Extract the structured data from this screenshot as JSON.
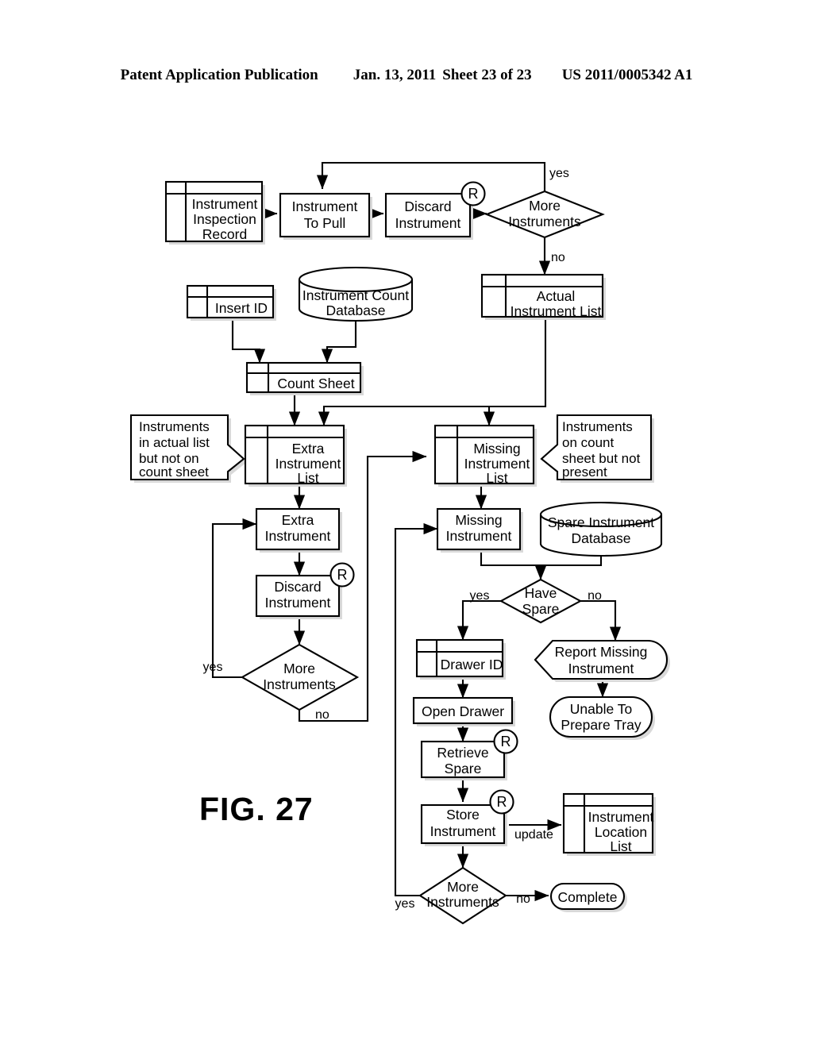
{
  "header": {
    "publication": "Patent Application Publication",
    "date": "Jan. 13, 2011",
    "sheet": "Sheet 23 of 23",
    "patent_number": "US 2011/0005342 A1"
  },
  "figure": {
    "label": "FIG. 27"
  },
  "colors": {
    "stroke": "#000000",
    "fill": "#ffffff",
    "shadow": "#d9d9d9"
  },
  "nodes": {
    "instrument_inspection_record": {
      "line1": "Instrument",
      "line2": "Inspection",
      "line3": "Record",
      "shape": "list"
    },
    "instrument_to_pull": {
      "line1": "Instrument",
      "line2": "To Pull",
      "shape": "process"
    },
    "discard_instrument_top": {
      "line1": "Discard",
      "line2": "Instrument",
      "shape": "process",
      "badge": "R"
    },
    "more_instruments_top": {
      "line1": "More",
      "line2": "Instruments",
      "shape": "decision"
    },
    "insert_id": {
      "line1": "Insert ID",
      "shape": "list"
    },
    "instrument_count_database": {
      "line1": "Instrument Count",
      "line2": "Database",
      "shape": "database"
    },
    "actual_instrument_list": {
      "line1": "Actual",
      "line2": "Instrument List",
      "shape": "list"
    },
    "count_sheet": {
      "line1": "Count Sheet",
      "shape": "list"
    },
    "extra_instrument_list": {
      "line1": "Extra",
      "line2": "Instrument",
      "line3": "List",
      "shape": "list"
    },
    "missing_instrument_list": {
      "line1": "Missing",
      "line2": "Instrument",
      "line3": "List",
      "shape": "list"
    },
    "extra_instrument": {
      "line1": "Extra",
      "line2": "Instrument",
      "shape": "process"
    },
    "discard_instrument_mid": {
      "line1": "Discard",
      "line2": "Instrument",
      "shape": "process",
      "badge": "R"
    },
    "more_instruments_left": {
      "line1": "More",
      "line2": "Instruments",
      "shape": "decision"
    },
    "missing_instrument": {
      "line1": "Missing",
      "line2": "Instrument",
      "shape": "process"
    },
    "spare_instrument_database": {
      "line1": "Spare Instrument",
      "line2": "Database",
      "shape": "database"
    },
    "have_spare": {
      "line1": "Have",
      "line2": "Spare",
      "shape": "decision"
    },
    "drawer_id": {
      "line1": "Drawer ID",
      "shape": "list"
    },
    "open_drawer": {
      "line1": "Open Drawer",
      "shape": "process"
    },
    "retrieve_spare": {
      "line1": "Retrieve",
      "line2": "Spare",
      "shape": "process",
      "badge": "R"
    },
    "store_instrument": {
      "line1": "Store",
      "line2": "Instrument",
      "shape": "process",
      "badge": "R"
    },
    "instrument_location_list": {
      "line1": "Instrument",
      "line2": "Location",
      "line3": "List",
      "shape": "list"
    },
    "more_instruments_bottom": {
      "line1": "More",
      "line2": "Instruments",
      "shape": "decision"
    },
    "report_missing_instrument": {
      "line1": "Report Missing",
      "line2": "Instrument",
      "shape": "display"
    },
    "unable_to_prepare_tray": {
      "line1": "Unable To",
      "line2": "Prepare Tray",
      "shape": "terminator"
    },
    "complete": {
      "line1": "Complete",
      "shape": "terminator"
    }
  },
  "annotations": {
    "extra_note": {
      "line1": "Instruments",
      "line2": "in actual list",
      "line3": "but not on",
      "line4": "count sheet"
    },
    "missing_note": {
      "line1": "Instruments",
      "line2": "on count",
      "line3": "sheet but not",
      "line4": "present"
    }
  },
  "edge_labels": {
    "yes_top": "yes",
    "no_top": "no",
    "yes_left": "yes",
    "no_left": "no",
    "yes_spare": "yes",
    "no_spare": "no",
    "update": "update",
    "yes_bottom": "yes",
    "no_bottom": "no"
  },
  "badges": {
    "r": "R"
  }
}
